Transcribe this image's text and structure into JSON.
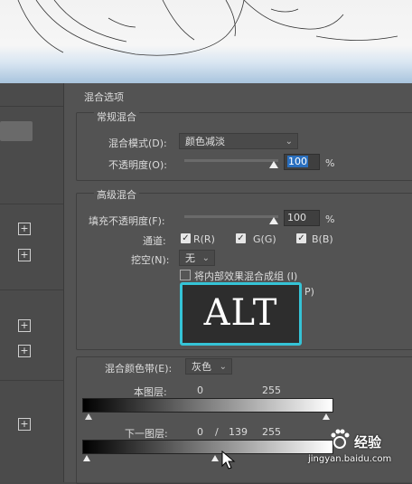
{
  "blending_options": {
    "section_title": "混合选项",
    "general": {
      "title": "常规混合",
      "blend_mode_label": "混合模式(D):",
      "blend_mode_value": "颜色减淡",
      "opacity_label": "不透明度(O):",
      "opacity_value": "100",
      "opacity_unit": "%",
      "opacity_fraction": 1.0
    },
    "advanced": {
      "title": "高级混合",
      "fill_opacity_label": "填充不透明度(F):",
      "fill_opacity_value": "100",
      "fill_opacity_unit": "%",
      "fill_opacity_fraction": 1.0,
      "channels_label": "通道:",
      "channel_r": "R(R)",
      "channel_g": "G(G)",
      "channel_b": "B(B)",
      "knockout_label": "挖空(N):",
      "knockout_value": "无",
      "blend_interior_label": "将内部效果混合成组 (I)",
      "partial_p": "P)"
    },
    "blend_if": {
      "label": "混合颜色带(E):",
      "value": "灰色",
      "this_layer_label": "本图层:",
      "this_layer_min": "0",
      "this_layer_max": "255",
      "underlying_label": "下一图层:",
      "underlying_min": "0",
      "underlying_sep": "/",
      "underlying_mid": "139",
      "underlying_max": "255"
    }
  },
  "overlay": {
    "key_badge": "ALT"
  },
  "watermark": {
    "brand": "经验",
    "url": "jingyan.baidu.com"
  },
  "colors": {
    "accent": "#35c3d6",
    "selection": "#2a6fbe",
    "panel": "#535353"
  },
  "icons": [
    "plus-icon",
    "chevron-down-icon",
    "checkmark-icon",
    "arrow-cursor-icon",
    "baidu-paw-icon"
  ]
}
